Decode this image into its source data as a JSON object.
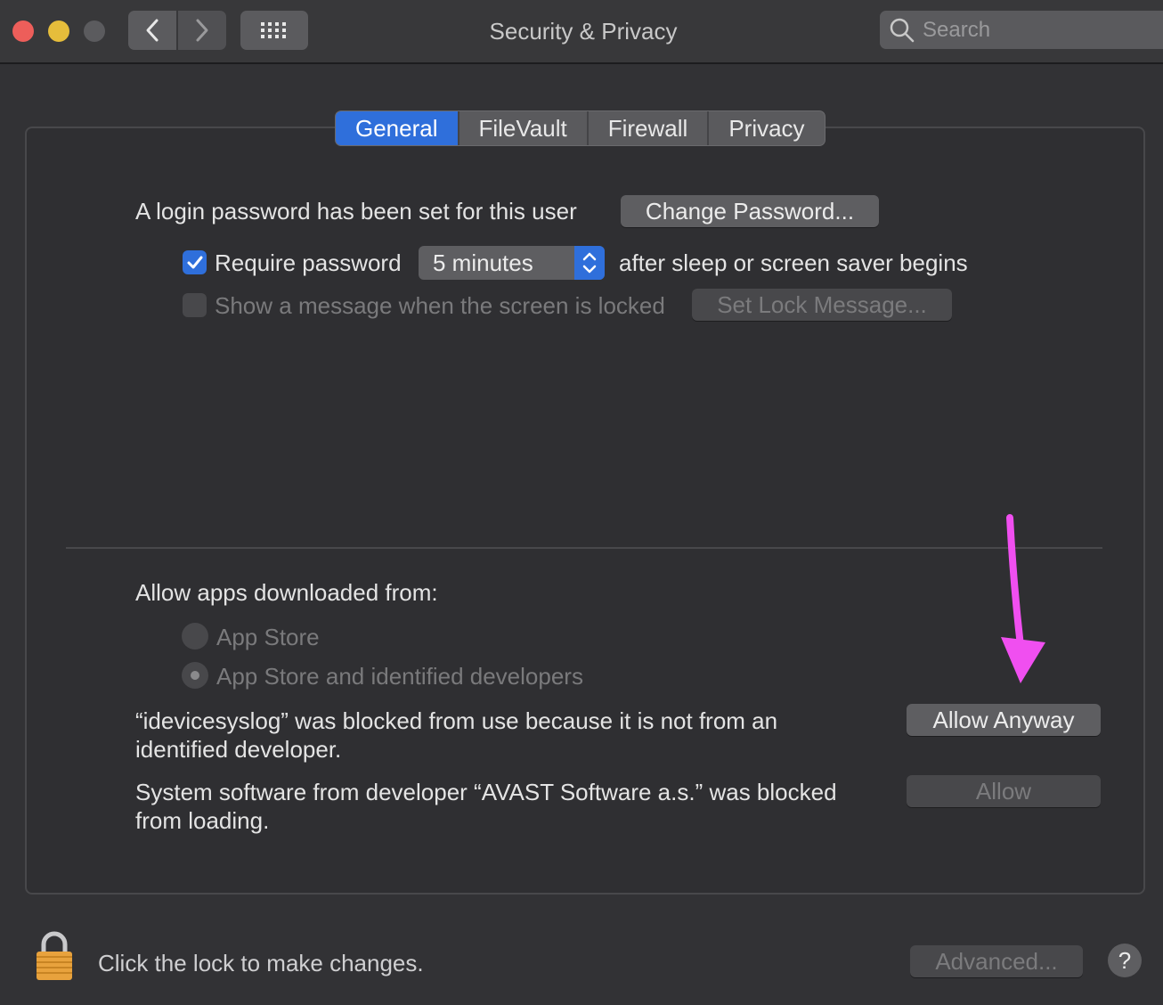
{
  "window": {
    "title": "Security & Privacy",
    "search_placeholder": "Search"
  },
  "tabs": [
    {
      "label": "General",
      "active": true
    },
    {
      "label": "FileVault",
      "active": false
    },
    {
      "label": "Firewall",
      "active": false
    },
    {
      "label": "Privacy",
      "active": false
    }
  ],
  "general": {
    "login_text": "A login password has been set for this user",
    "change_password_label": "Change Password...",
    "require_password": {
      "label": "Require password",
      "checked": true,
      "delay_value": "5 minutes",
      "suffix": "after sleep or screen saver begins"
    },
    "lock_message": {
      "label": "Show a message when the screen is locked",
      "checked": false,
      "button_label": "Set Lock Message..."
    }
  },
  "gatekeeper": {
    "heading": "Allow apps downloaded from:",
    "options": [
      {
        "label": "App Store",
        "selected": false
      },
      {
        "label": "App Store and identified developers",
        "selected": true
      }
    ],
    "blocked_app_text": "“idevicesyslog” was blocked from use because it is not from an identified developer.",
    "allow_anyway_label": "Allow Anyway",
    "blocked_system_text": "System software from developer “AVAST Software a.s.” was blocked from loading.",
    "allow_label": "Allow"
  },
  "footer": {
    "lock_text": "Click the lock to make changes.",
    "advanced_label": "Advanced...",
    "help_label": "?"
  },
  "annotation": {
    "arrow_color": "#f04ff0"
  },
  "colors": {
    "accent": "#2f6fdb",
    "window_bg": "#323235"
  }
}
